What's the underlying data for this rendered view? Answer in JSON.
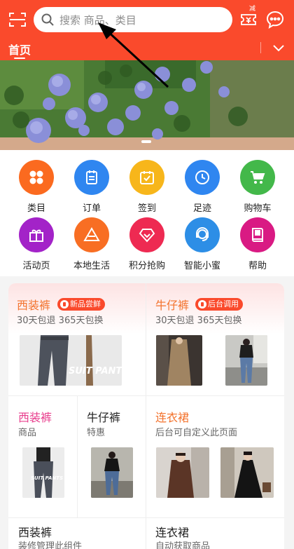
{
  "colors": {
    "header": "#fa4a2c",
    "accent": "#f05a28"
  },
  "header": {
    "search_placeholder": "搜索 商品、类目",
    "coupon_badge": "减",
    "tabs": [
      {
        "label": "首页",
        "active": true
      }
    ],
    "icons": {
      "scan": "scan-icon",
      "search": "search-icon",
      "coupon": "coupon-icon",
      "chat": "chat-icon",
      "more": "chevron-down-icon"
    }
  },
  "shortcuts": [
    {
      "label": "类目",
      "icon": "category-icon",
      "color": "#fb6a1f"
    },
    {
      "label": "订单",
      "icon": "order-icon",
      "color": "#2f86f0"
    },
    {
      "label": "签到",
      "icon": "checkin-icon",
      "color": "#f7b61b"
    },
    {
      "label": "足迹",
      "icon": "footprint-icon",
      "color": "#2f86f0"
    },
    {
      "label": "购物车",
      "icon": "cart-icon",
      "color": "#43b84a"
    },
    {
      "label": "活动页",
      "icon": "gift-icon",
      "color": "#a323c8"
    },
    {
      "label": "本地生活",
      "icon": "local-icon",
      "color": "#f86e23"
    },
    {
      "label": "积分抢购",
      "icon": "diamond-icon",
      "color": "#ee2a52"
    },
    {
      "label": "智能小蜜",
      "icon": "assistant-icon",
      "color": "#2d8ee6"
    },
    {
      "label": "帮助",
      "icon": "help-icon",
      "color": "#d91a83"
    }
  ],
  "promo": {
    "card1": {
      "title": "西装裤",
      "tag": "新品尝鲜",
      "sub": "30天包退 365天包换",
      "img_text": "SUIT PANTS"
    },
    "card2": {
      "title": "牛仔裤",
      "tag": "后台调用",
      "sub": "30天包退 365天包换"
    },
    "card3": {
      "title": "西装裤",
      "sub": "商品",
      "img_text": "SUIT PANTS"
    },
    "card4": {
      "title": "牛仔裤",
      "sub": "特惠"
    },
    "card5": {
      "title": "连衣裙",
      "sub": "后台可自定义此页面"
    },
    "card6": {
      "title": "西装裤",
      "sub": "装修管理此组件"
    },
    "card7": {
      "title": "连衣裙",
      "sub": "自动获取商品"
    }
  }
}
